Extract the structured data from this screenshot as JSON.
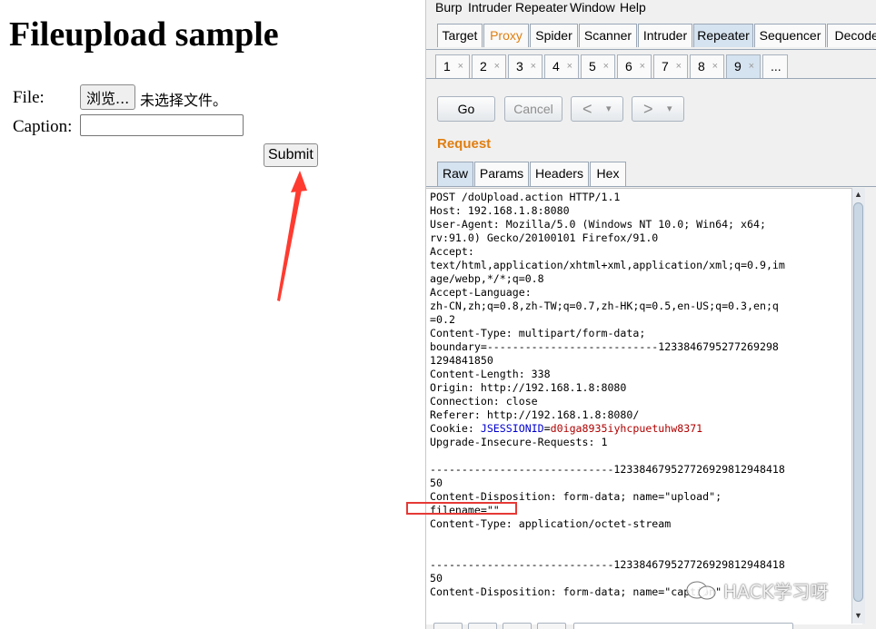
{
  "page": {
    "heading": "Fileupload sample",
    "file_label": "File:",
    "browse_label": "浏览...",
    "no_file_text": "未选择文件。",
    "caption_label": "Caption:",
    "caption_value": "",
    "submit_label": "Submit",
    "arrow_color": "#ff3b30"
  },
  "burp": {
    "menu": [
      "Burp",
      "Intruder",
      "Repeater",
      "Window",
      "Help"
    ],
    "tool_tabs": [
      "Target",
      "Proxy",
      "Spider",
      "Scanner",
      "Intruder",
      "Repeater",
      "Sequencer",
      "Decoder"
    ],
    "active_tool_tab": "Repeater",
    "highlight_tool_tab": "Proxy",
    "request_tabs": [
      "1",
      "2",
      "3",
      "4",
      "5",
      "6",
      "7",
      "8",
      "9",
      "..."
    ],
    "active_request_tab": "9",
    "close_glyph": "×",
    "go_label": "Go",
    "cancel_label": "Cancel",
    "back_label": "<",
    "forward_label": ">",
    "dropdown_glyph": "▾",
    "request_title": "Request",
    "view_tabs": [
      "Raw",
      "Params",
      "Headers",
      "Hex"
    ],
    "active_view_tab": "Raw",
    "request_lines_before": [
      "POST /doUpload.action HTTP/1.1",
      "Host: 192.168.1.8:8080",
      "User-Agent: Mozilla/5.0 (Windows NT 10.0; Win64; x64;",
      "rv:91.0) Gecko/20100101 Firefox/91.0",
      "Accept:",
      "text/html,application/xhtml+xml,application/xml;q=0.9,im",
      "age/webp,*/*;q=0.8",
      "Accept-Language:",
      "zh-CN,zh;q=0.8,zh-TW;q=0.7,zh-HK;q=0.5,en-US;q=0.3,en;q",
      "=0.2",
      "Content-Type: multipart/form-data;",
      "boundary=---------------------------1233846795277269298",
      "1294841850",
      "Content-Length: 338",
      "Origin: http://192.168.1.8:8080",
      "Connection: close",
      "Referer: http://192.168.1.8:8080/"
    ],
    "cookie_prefix": "Cookie: ",
    "cookie_key": "JSESSIONID",
    "cookie_eq": "=",
    "cookie_value": "d0iga8935iyhcpuetuhw8371",
    "request_lines_after": [
      "Upgrade-Insecure-Requests: 1",
      "",
      "-----------------------------123384679527726929812948418",
      "50",
      "Content-Disposition: form-data; name=\"upload\";",
      "filename=\"\"",
      "Content-Type: application/octet-stream",
      "",
      "",
      "-----------------------------123384679527726929812948418",
      "50",
      "Content-Disposition: form-data; name=\"caption\""
    ],
    "highlight_color": "#e53935",
    "accent_color": "#e07e10",
    "scroll_up_glyph": "▲",
    "scroll_down_glyph": "▼"
  },
  "watermark": "HACK学习呀"
}
